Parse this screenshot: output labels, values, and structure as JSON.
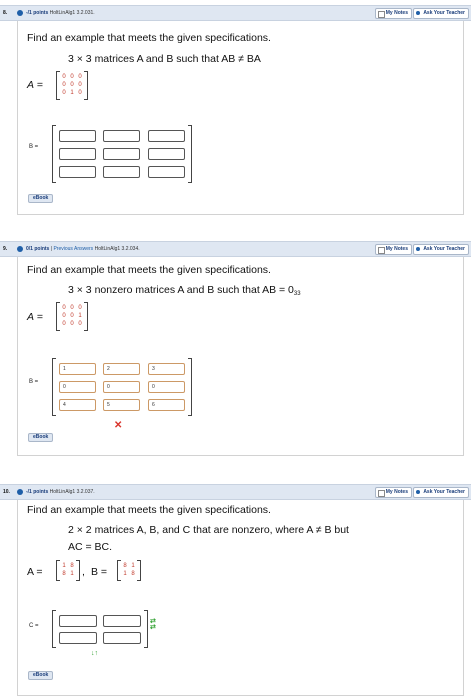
{
  "questions": [
    {
      "number": "8.",
      "points": "-/1 points",
      "reference": "HoltLinAlg1 3.2.031.",
      "previous_answers": "",
      "my_notes": "My Notes",
      "ask_teacher": "Ask Your Teacher",
      "prompt": "Find an example that meets the given specifications.",
      "spec": "3 × 3 matrices A and B such that AB ≠ BA",
      "matrix_A": [
        [
          "0",
          "0",
          "0"
        ],
        [
          "0",
          "0",
          "0"
        ],
        [
          "0",
          "1",
          "0"
        ]
      ],
      "answer_label": "B =",
      "inputs": [
        "",
        "",
        "",
        "",
        "",
        "",
        "",
        "",
        ""
      ],
      "ebook": "eBook"
    },
    {
      "number": "9.",
      "points": "0/1 points",
      "reference": "HoltLinAlg1 3.2.034.",
      "previous_answers": "Previous Answers",
      "my_notes": "My Notes",
      "ask_teacher": "Ask Your Teacher",
      "prompt": "Find an example that meets the given specifications.",
      "spec_prefix": "3 × 3 nonzero matrices A and B such that AB = 0",
      "spec_sub": "33",
      "matrix_A": [
        [
          "0",
          "0",
          "0"
        ],
        [
          "0",
          "0",
          "1"
        ],
        [
          "0",
          "0",
          "0"
        ]
      ],
      "answer_label": "B =",
      "inputs": [
        "1",
        "2",
        "3",
        "0",
        "0",
        "0",
        "4",
        "5",
        "6"
      ],
      "result_mark": "✕",
      "ebook": "eBook"
    },
    {
      "number": "10.",
      "points": "-/1 points",
      "reference": "HoltLinAlg1 3.2.037.",
      "previous_answers": "",
      "my_notes": "My Notes",
      "ask_teacher": "Ask Your Teacher",
      "prompt": "Find an example that meets the given specifications.",
      "spec_line1": "2 × 2 matrices A, B, and C that are nonzero, where A ≠ B but",
      "spec_line2": "AC = BC.",
      "matrix_A": [
        [
          "1",
          "8"
        ],
        [
          "8",
          "1"
        ]
      ],
      "matrix_B": [
        [
          "8",
          "1"
        ],
        [
          "1",
          "8"
        ]
      ],
      "label_A": "A =",
      "label_B": "B =",
      "answer_label": "C =",
      "inputs": [
        "",
        "",
        "",
        ""
      ],
      "ebook": "eBook"
    }
  ],
  "colors": {
    "header_bg": "#dfe7f2",
    "link": "#1f5fa8",
    "matrix_entries": "#c0392b",
    "error": "#d9342b",
    "resize_arrows": "#3aa53a"
  }
}
